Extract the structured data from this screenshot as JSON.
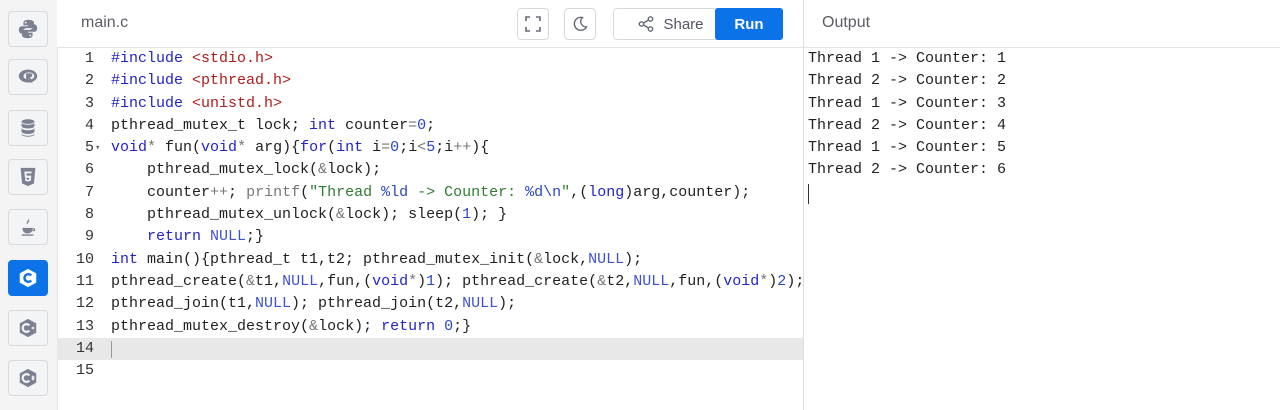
{
  "sidebar": {
    "languages": [
      {
        "icon": "python-icon",
        "label": "Python",
        "active": false
      },
      {
        "icon": "r-icon",
        "label": "R",
        "active": false
      },
      {
        "icon": "database-icon",
        "label": "SQL",
        "active": false
      },
      {
        "icon": "html5-icon",
        "label": "HTML",
        "active": false
      },
      {
        "icon": "java-icon",
        "label": "Java",
        "active": false
      },
      {
        "icon": "c-icon",
        "label": "C",
        "active": true
      },
      {
        "icon": "cpp-icon",
        "label": "C++",
        "active": false
      },
      {
        "icon": "csharp-icon",
        "label": "C#",
        "active": false
      }
    ]
  },
  "toolbar": {
    "filename": "main.c",
    "share_label": "Share",
    "run_label": "Run"
  },
  "output": {
    "title": "Output",
    "lines": [
      "Thread 1 -> Counter: 1",
      "Thread 2 -> Counter: 2",
      "Thread 1 -> Counter: 3",
      "Thread 2 -> Counter: 4",
      "Thread 1 -> Counter: 5",
      "Thread 2 -> Counter: 6"
    ]
  },
  "editor": {
    "active_line": 14,
    "lines": [
      {
        "n": "1",
        "tokens": [
          [
            "kw",
            "#include"
          ],
          [
            "",
            " "
          ],
          [
            "hd",
            "<stdio.h>"
          ]
        ]
      },
      {
        "n": "2",
        "tokens": [
          [
            "kw",
            "#include"
          ],
          [
            "",
            " "
          ],
          [
            "hd",
            "<pthread.h>"
          ]
        ]
      },
      {
        "n": "3",
        "tokens": [
          [
            "kw",
            "#include"
          ],
          [
            "",
            " "
          ],
          [
            "hd",
            "<unistd.h>"
          ]
        ]
      },
      {
        "n": "4",
        "tokens": [
          [
            "",
            "pthread_mutex_t lock; "
          ],
          [
            "kw",
            "int"
          ],
          [
            "",
            " counter"
          ],
          [
            "op",
            "="
          ],
          [
            "nu",
            "0"
          ],
          [
            "",
            ";"
          ]
        ]
      },
      {
        "n": "5",
        "fold": true,
        "tokens": [
          [
            "kw",
            "void"
          ],
          [
            "op",
            "*"
          ],
          [
            "",
            " fun("
          ],
          [
            "kw",
            "void"
          ],
          [
            "op",
            "*"
          ],
          [
            "",
            " arg){"
          ],
          [
            "kw",
            "for"
          ],
          [
            "",
            "("
          ],
          [
            "kw",
            "int"
          ],
          [
            "",
            " i"
          ],
          [
            "op",
            "="
          ],
          [
            "nu",
            "0"
          ],
          [
            "",
            ";i"
          ],
          [
            "op",
            "<"
          ],
          [
            "nu",
            "5"
          ],
          [
            "",
            ";i"
          ],
          [
            "op",
            "++"
          ],
          [
            "",
            "){"
          ]
        ]
      },
      {
        "n": "6",
        "tokens": [
          [
            "",
            "    pthread_mutex_lock("
          ],
          [
            "op",
            "&"
          ],
          [
            "",
            "lock);"
          ]
        ]
      },
      {
        "n": "7",
        "tokens": [
          [
            "",
            "    counter"
          ],
          [
            "op",
            "++"
          ],
          [
            "",
            "; "
          ],
          [
            "op",
            "printf"
          ],
          [
            "",
            "("
          ],
          [
            "st",
            "\"Thread "
          ],
          [
            "nu",
            "%ld"
          ],
          [
            "st",
            " -> Counter: "
          ],
          [
            "nu",
            "%d\\n"
          ],
          [
            "st",
            "\""
          ],
          [
            "",
            ",("
          ],
          [
            "kw",
            "long"
          ],
          [
            "",
            ")arg,counter);"
          ]
        ]
      },
      {
        "n": "8",
        "tokens": [
          [
            "",
            "    pthread_mutex_unlock("
          ],
          [
            "op",
            "&"
          ],
          [
            "",
            "lock); sleep("
          ],
          [
            "nu",
            "1"
          ],
          [
            "",
            "); }"
          ]
        ]
      },
      {
        "n": "9",
        "tokens": [
          [
            "",
            "    "
          ],
          [
            "kw",
            "return"
          ],
          [
            "",
            ""
          ],
          [
            "nl",
            " NULL"
          ],
          [
            "",
            ";}"
          ]
        ]
      },
      {
        "n": "10",
        "tokens": [
          [
            "kw",
            "int"
          ],
          [
            "",
            " main(){pthread_t t1,t2; pthread_mutex_init("
          ],
          [
            "op",
            "&"
          ],
          [
            "",
            "lock,"
          ],
          [
            "nl",
            "NULL"
          ],
          [
            "",
            ");"
          ]
        ]
      },
      {
        "n": "11",
        "tokens": [
          [
            "",
            "pthread_create("
          ],
          [
            "op",
            "&"
          ],
          [
            "",
            "t1,"
          ],
          [
            "nl",
            "NULL"
          ],
          [
            "",
            ",fun,("
          ],
          [
            "kw",
            "void"
          ],
          [
            "op",
            "*"
          ],
          [
            "",
            ")"
          ],
          [
            "nu",
            "1"
          ],
          [
            "",
            "); pthread_create("
          ],
          [
            "op",
            "&"
          ],
          [
            "",
            "t2,"
          ],
          [
            "nl",
            "NULL"
          ],
          [
            "",
            ",fun,("
          ],
          [
            "kw",
            "void"
          ],
          [
            "op",
            "*"
          ],
          [
            "",
            ")"
          ],
          [
            "nu",
            "2"
          ],
          [
            "",
            ");"
          ]
        ]
      },
      {
        "n": "12",
        "tokens": [
          [
            "",
            "pthread_join(t1,"
          ],
          [
            "nl",
            "NULL"
          ],
          [
            "",
            "); pthread_join(t2,"
          ],
          [
            "nl",
            "NULL"
          ],
          [
            "",
            ");"
          ]
        ]
      },
      {
        "n": "13",
        "tokens": [
          [
            "",
            "pthread_mutex_destroy("
          ],
          [
            "op",
            "&"
          ],
          [
            "",
            "lock); "
          ],
          [
            "kw",
            "return"
          ],
          [
            "",
            ""
          ],
          [
            "nu",
            " 0"
          ],
          [
            "",
            ";}"
          ]
        ]
      },
      {
        "n": "14",
        "tokens": []
      },
      {
        "n": "15",
        "tokens": []
      }
    ]
  }
}
